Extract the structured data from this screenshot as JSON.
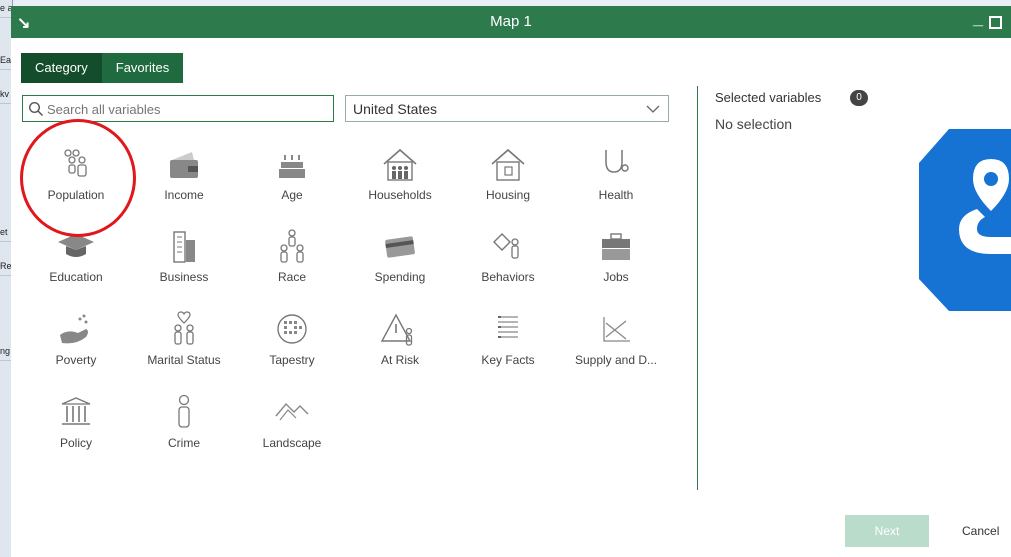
{
  "background": {
    "cells": [
      "e ad",
      "Ea",
      "kv",
      "et",
      "Re",
      "ng"
    ]
  },
  "dialog": {
    "title": "Map 1",
    "collapse_icon": "collapse-arrow-icon",
    "accent": "#2d7a4c"
  },
  "tabs": [
    {
      "label": "Category",
      "active": true
    },
    {
      "label": "Favorites",
      "active": false
    }
  ],
  "search": {
    "placeholder": "Search all variables",
    "value": ""
  },
  "region": {
    "selected": "United States"
  },
  "categories": [
    {
      "label": "Population",
      "icon": "population-icon"
    },
    {
      "label": "Income",
      "icon": "wallet-icon"
    },
    {
      "label": "Age",
      "icon": "birthday-cake-icon"
    },
    {
      "label": "Households",
      "icon": "households-icon"
    },
    {
      "label": "Housing",
      "icon": "house-icon"
    },
    {
      "label": "Health",
      "icon": "stethoscope-icon"
    },
    {
      "label": "Education",
      "icon": "graduation-cap-icon"
    },
    {
      "label": "Business",
      "icon": "buildings-icon"
    },
    {
      "label": "Race",
      "icon": "people-group-icon"
    },
    {
      "label": "Spending",
      "icon": "credit-card-icon"
    },
    {
      "label": "Behaviors",
      "icon": "behaviors-icon"
    },
    {
      "label": "Jobs",
      "icon": "briefcase-icon"
    },
    {
      "label": "Poverty",
      "icon": "hand-coins-icon"
    },
    {
      "label": "Marital Status",
      "icon": "heart-couple-icon"
    },
    {
      "label": "Tapestry",
      "icon": "tapestry-icon"
    },
    {
      "label": "At Risk",
      "icon": "warning-person-icon"
    },
    {
      "label": "Key Facts",
      "icon": "list-icon"
    },
    {
      "label": "Supply and D...",
      "icon": "supply-demand-icon"
    },
    {
      "label": "Policy",
      "icon": "government-building-icon"
    },
    {
      "label": "Crime",
      "icon": "person-icon"
    },
    {
      "label": "Landscape",
      "icon": "mountain-icon"
    }
  ],
  "selected_panel": {
    "title": "Selected variables",
    "count": "0",
    "empty_text": "No selection"
  },
  "footer": {
    "next_label": "Next",
    "cancel_label": "Cancel"
  }
}
